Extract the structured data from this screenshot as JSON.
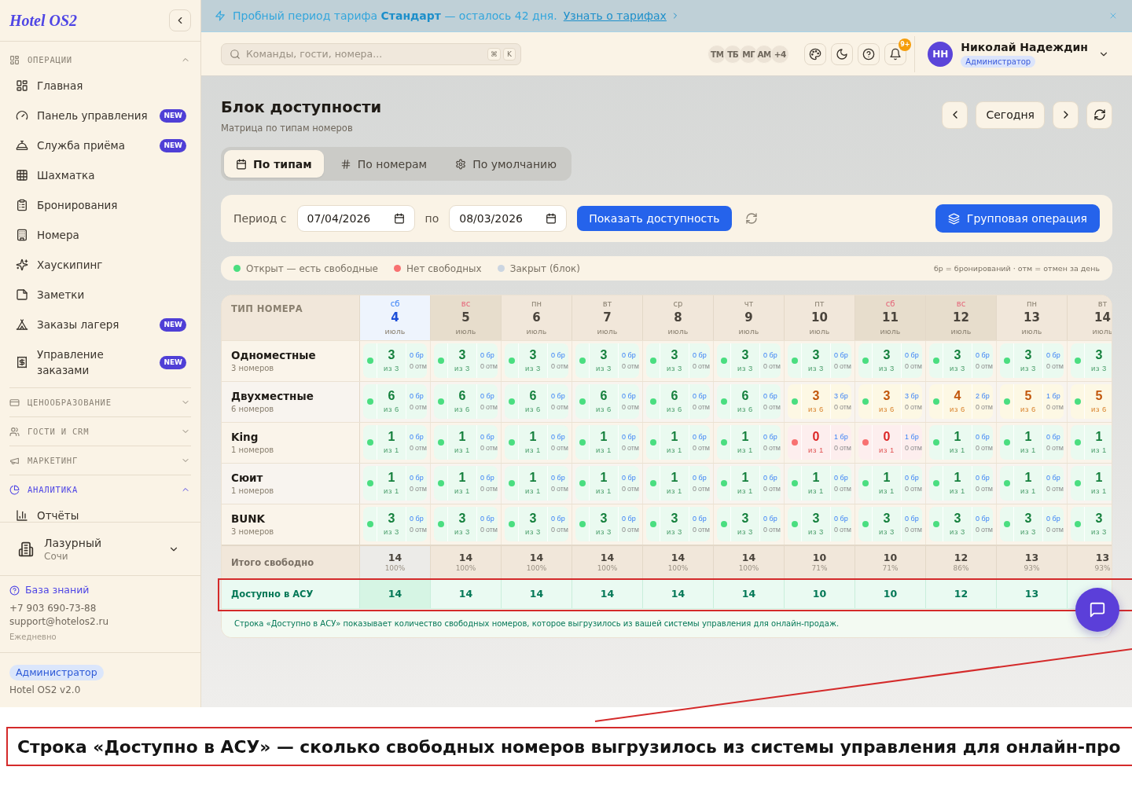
{
  "sidebar": {
    "logo": "Hotel OS2",
    "sections": [
      {
        "label": "ОПЕРАЦИИ",
        "expanded": true,
        "active": false,
        "items": [
          {
            "label": "Главная",
            "selected": false
          },
          {
            "label": "Панель управления",
            "badge": "NEW",
            "selected": false
          },
          {
            "label": "Служба приёма",
            "badge": "NEW",
            "selected": false
          },
          {
            "label": "Шахматка",
            "selected": false
          },
          {
            "label": "Бронирования",
            "selected": false
          },
          {
            "label": "Номера",
            "selected": false
          },
          {
            "label": "Хаускипинг",
            "selected": false
          },
          {
            "label": "Заметки",
            "selected": false
          },
          {
            "label": "Заказы лагеря",
            "badge": "NEW",
            "selected": false
          },
          {
            "label": "Управление заказами",
            "badge": "NEW",
            "selected": false
          }
        ]
      },
      {
        "label": "ЦЕНООБРАЗОВАНИЕ",
        "expanded": false,
        "active": false
      },
      {
        "label": "ГОСТИ И CRM",
        "expanded": false,
        "active": false
      },
      {
        "label": "МАРКЕТИНГ",
        "expanded": false,
        "active": false
      },
      {
        "label": "АНАЛИТИКА",
        "expanded": true,
        "active": true,
        "items": [
          {
            "label": "Отчёты",
            "selected": false
          }
        ]
      }
    ],
    "hotel": {
      "name": "Лазурный",
      "city": "Сочи"
    },
    "support": {
      "link": "База знаний",
      "phone": "+7 903 690-73-88",
      "email": "support@hotelos2.ru",
      "hours": "Ежедневно"
    },
    "role": "Администратор",
    "version": "Hotel OS2 v2.0"
  },
  "banner": {
    "text": "Пробный период тарифа **Стандарт** — осталось 42 дня.",
    "link": "Узнать о тарифах"
  },
  "topbar": {
    "search": {
      "placeholder": "Команды, гости, номера...",
      "keys": [
        "⌘",
        "K"
      ]
    },
    "avatars": [
      "ТМ",
      "ТБ",
      "МГ",
      "АМ"
    ],
    "more": "+4",
    "notifications": "9+",
    "user": {
      "initials": "НН",
      "name": "Николай Надеждин",
      "role": "Администратор"
    }
  },
  "page": {
    "title": "Блок доступности",
    "subtitle": "Матрица по типам номеров",
    "today_button": "Сегодня"
  },
  "tabs": [
    {
      "label": "По типам",
      "selected": true
    },
    {
      "label": "По номерам",
      "selected": false
    },
    {
      "label": "По умолчанию",
      "selected": false
    }
  ],
  "filter": {
    "from_label": "Период с",
    "date_from": "07/04/2026",
    "to_label": "по",
    "date_to": "08/03/2026",
    "submit": "Показать доступность",
    "group_action": "Групповая операция"
  },
  "legend": {
    "items": [
      {
        "label": "Открыт — есть свободные",
        "color": "#4ade80"
      },
      {
        "label": "Нет свободных",
        "color": "#f87171"
      },
      {
        "label": "Закрыт (блок)",
        "color": "#cbd5e1"
      }
    ],
    "note": "бр = бронирований · отм = отмен за день"
  },
  "matrix": {
    "header": "ТИП НОМЕРА",
    "columns": [
      {
        "weekday": "сб",
        "day": "4",
        "month": "июль",
        "today": true,
        "weekend": false
      },
      {
        "weekday": "вс",
        "day": "5",
        "month": "июль",
        "today": false,
        "weekend": true
      },
      {
        "weekday": "пн",
        "day": "6",
        "month": "июль",
        "today": false,
        "weekend": false
      },
      {
        "weekday": "вт",
        "day": "7",
        "month": "июль",
        "today": false,
        "weekend": false
      },
      {
        "weekday": "ср",
        "day": "8",
        "month": "июль",
        "today": false,
        "weekend": false
      },
      {
        "weekday": "чт",
        "day": "9",
        "month": "июль",
        "today": false,
        "weekend": false
      },
      {
        "weekday": "пт",
        "day": "10",
        "month": "июль",
        "today": false,
        "weekend": false
      },
      {
        "weekday": "сб",
        "day": "11",
        "month": "июль",
        "today": false,
        "weekend": true
      },
      {
        "weekday": "вс",
        "day": "12",
        "month": "июль",
        "today": false,
        "weekend": true
      },
      {
        "weekday": "пн",
        "day": "13",
        "month": "июль",
        "today": false,
        "weekend": false
      },
      {
        "weekday": "вт",
        "day": "14",
        "month": "июль",
        "today": false,
        "weekend": false
      }
    ],
    "rows": [
      {
        "name": "Одноместные",
        "count": "3 номеров",
        "cells": [
          {
            "available": "3",
            "total": "из 3",
            "booked": "0 бр",
            "cancelled": "0 отм",
            "kind": "free"
          },
          {
            "available": "3",
            "total": "из 3",
            "booked": "0 бр",
            "cancelled": "0 отм",
            "kind": "free"
          },
          {
            "available": "3",
            "total": "из 3",
            "booked": "0 бр",
            "cancelled": "0 отм",
            "kind": "free"
          },
          {
            "available": "3",
            "total": "из 3",
            "booked": "0 бр",
            "cancelled": "0 отм",
            "kind": "free"
          },
          {
            "available": "3",
            "total": "из 3",
            "booked": "0 бр",
            "cancelled": "0 отм",
            "kind": "free"
          },
          {
            "available": "3",
            "total": "из 3",
            "booked": "0 бр",
            "cancelled": "0 отм",
            "kind": "free"
          },
          {
            "available": "3",
            "total": "из 3",
            "booked": "0 бр",
            "cancelled": "0 отм",
            "kind": "free"
          },
          {
            "available": "3",
            "total": "из 3",
            "booked": "0 бр",
            "cancelled": "0 отм",
            "kind": "free"
          },
          {
            "available": "3",
            "total": "из 3",
            "booked": "0 бр",
            "cancelled": "0 отм",
            "kind": "free"
          },
          {
            "available": "3",
            "total": "из 3",
            "booked": "0 бр",
            "cancelled": "0 отм",
            "kind": "free"
          },
          {
            "available": "3",
            "total": "из 3",
            "kind": "free"
          }
        ]
      },
      {
        "name": "Двухместные",
        "count": "6 номеров",
        "cells": [
          {
            "available": "6",
            "total": "из 6",
            "booked": "0 бр",
            "cancelled": "0 отм",
            "kind": "free"
          },
          {
            "available": "6",
            "total": "из 6",
            "booked": "0 бр",
            "cancelled": "0 отм",
            "kind": "free"
          },
          {
            "available": "6",
            "total": "из 6",
            "booked": "0 бр",
            "cancelled": "0 отм",
            "kind": "free"
          },
          {
            "available": "6",
            "total": "из 6",
            "booked": "0 бр",
            "cancelled": "0 отм",
            "kind": "free"
          },
          {
            "available": "6",
            "total": "из 6",
            "booked": "0 бр",
            "cancelled": "0 отм",
            "kind": "free"
          },
          {
            "available": "6",
            "total": "из 6",
            "booked": "0 бр",
            "cancelled": "0 отм",
            "kind": "free"
          },
          {
            "available": "3",
            "total": "из 6",
            "booked": "3 бр",
            "cancelled": "0 отм",
            "kind": "partial"
          },
          {
            "available": "3",
            "total": "из 6",
            "booked": "3 бр",
            "cancelled": "0 отм",
            "kind": "partial"
          },
          {
            "available": "4",
            "total": "из 6",
            "booked": "2 бр",
            "cancelled": "0 отм",
            "kind": "partial"
          },
          {
            "available": "5",
            "total": "из 6",
            "booked": "1 бр",
            "cancelled": "0 отм",
            "kind": "partial"
          },
          {
            "available": "5",
            "total": "из 6",
            "kind": "partial"
          }
        ]
      },
      {
        "name": "King",
        "count": "1 номеров",
        "cells": [
          {
            "available": "1",
            "total": "из 1",
            "booked": "0 бр",
            "cancelled": "0 отм",
            "kind": "free"
          },
          {
            "available": "1",
            "total": "из 1",
            "booked": "0 бр",
            "cancelled": "0 отм",
            "kind": "free"
          },
          {
            "available": "1",
            "total": "из 1",
            "booked": "0 бр",
            "cancelled": "0 отм",
            "kind": "free"
          },
          {
            "available": "1",
            "total": "из 1",
            "booked": "0 бр",
            "cancelled": "0 отм",
            "kind": "free"
          },
          {
            "available": "1",
            "total": "из 1",
            "booked": "0 бр",
            "cancelled": "0 отм",
            "kind": "free"
          },
          {
            "available": "1",
            "total": "из 1",
            "booked": "0 бр",
            "cancelled": "0 отм",
            "kind": "free"
          },
          {
            "available": "0",
            "total": "из 1",
            "booked": "1 бр",
            "cancelled": "0 отм",
            "kind": "soldout"
          },
          {
            "available": "0",
            "total": "из 1",
            "booked": "1 бр",
            "cancelled": "0 отм",
            "kind": "soldout"
          },
          {
            "available": "1",
            "total": "из 1",
            "booked": "0 бр",
            "cancelled": "0 отм",
            "kind": "free"
          },
          {
            "available": "1",
            "total": "из 1",
            "booked": "0 бр",
            "cancelled": "0 отм",
            "kind": "free"
          },
          {
            "available": "1",
            "total": "из 1",
            "kind": "free"
          }
        ]
      },
      {
        "name": "Сюит",
        "count": "1 номеров",
        "cells": [
          {
            "available": "1",
            "total": "из 1",
            "booked": "0 бр",
            "cancelled": "0 отм",
            "kind": "free"
          },
          {
            "available": "1",
            "total": "из 1",
            "booked": "0 бр",
            "cancelled": "0 отм",
            "kind": "free"
          },
          {
            "available": "1",
            "total": "из 1",
            "booked": "0 бр",
            "cancelled": "0 отм",
            "kind": "free"
          },
          {
            "available": "1",
            "total": "из 1",
            "booked": "0 бр",
            "cancelled": "0 отм",
            "kind": "free"
          },
          {
            "available": "1",
            "total": "из 1",
            "booked": "0 бр",
            "cancelled": "0 отм",
            "kind": "free"
          },
          {
            "available": "1",
            "total": "из 1",
            "booked": "0 бр",
            "cancelled": "0 отм",
            "kind": "free"
          },
          {
            "available": "1",
            "total": "из 1",
            "booked": "0 бр",
            "cancelled": "0 отм",
            "kind": "free"
          },
          {
            "available": "1",
            "total": "из 1",
            "booked": "0 бр",
            "cancelled": "0 отм",
            "kind": "free"
          },
          {
            "available": "1",
            "total": "из 1",
            "booked": "0 бр",
            "cancelled": "0 отм",
            "kind": "free"
          },
          {
            "available": "1",
            "total": "из 1",
            "booked": "0 бр",
            "cancelled": "0 отм",
            "kind": "free"
          },
          {
            "available": "1",
            "total": "из 1",
            "kind": "free"
          }
        ]
      },
      {
        "name": "BUNK",
        "count": "3 номеров",
        "cells": [
          {
            "available": "3",
            "total": "из 3",
            "booked": "0 бр",
            "cancelled": "0 отм",
            "kind": "free"
          },
          {
            "available": "3",
            "total": "из 3",
            "booked": "0 бр",
            "cancelled": "0 отм",
            "kind": "free"
          },
          {
            "available": "3",
            "total": "из 3",
            "booked": "0 бр",
            "cancelled": "0 отм",
            "kind": "free"
          },
          {
            "available": "3",
            "total": "из 3",
            "booked": "0 бр",
            "cancelled": "0 отм",
            "kind": "free"
          },
          {
            "available": "3",
            "total": "из 3",
            "booked": "0 бр",
            "cancelled": "0 отм",
            "kind": "free"
          },
          {
            "available": "3",
            "total": "из 3",
            "booked": "0 бр",
            "cancelled": "0 отм",
            "kind": "free"
          },
          {
            "available": "3",
            "total": "из 3",
            "booked": "0 бр",
            "cancelled": "0 отм",
            "kind": "free"
          },
          {
            "available": "3",
            "total": "из 3",
            "booked": "0 бр",
            "cancelled": "0 отм",
            "kind": "free"
          },
          {
            "available": "3",
            "total": "из 3",
            "booked": "0 бр",
            "cancelled": "0 отм",
            "kind": "free"
          },
          {
            "available": "3",
            "total": "из 3",
            "booked": "0 бр",
            "cancelled": "0 отм",
            "kind": "free"
          },
          {
            "available": "3",
            "total": "из 3",
            "kind": "free"
          }
        ]
      }
    ],
    "totals": {
      "label": "Итого свободно",
      "cells": [
        {
          "value": "14",
          "percent": "100%"
        },
        {
          "value": "14",
          "percent": "100%"
        },
        {
          "value": "14",
          "percent": "100%"
        },
        {
          "value": "14",
          "percent": "100%"
        },
        {
          "value": "14",
          "percent": "100%"
        },
        {
          "value": "14",
          "percent": "100%"
        },
        {
          "value": "10",
          "percent": "71%"
        },
        {
          "value": "10",
          "percent": "71%"
        },
        {
          "value": "12",
          "percent": "86%"
        },
        {
          "value": "13",
          "percent": "93%"
        },
        {
          "value": "13",
          "percent": "93%"
        }
      ]
    },
    "asu": {
      "label": "Доступно в АСУ",
      "values": [
        "14",
        "14",
        "14",
        "14",
        "14",
        "14",
        "10",
        "10",
        "12",
        "13"
      ]
    },
    "footnote": "Строка «Доступно в АСУ» показывает количество свободных номеров, которое выгрузилось из вашей системы управления для онлайн-продаж."
  },
  "annotation": {
    "caption": "Строка «Доступно в АСУ» — сколько свободных номеров выгрузилось из системы управления для онлайн-про"
  }
}
